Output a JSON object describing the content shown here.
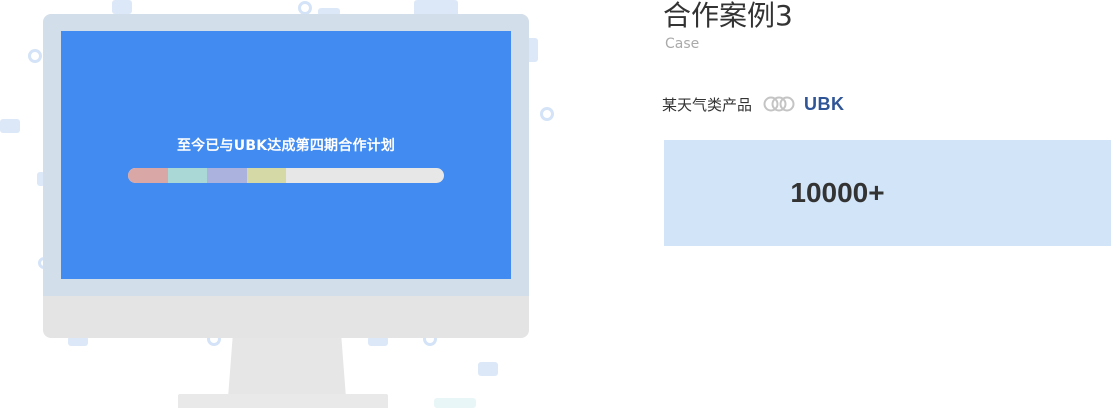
{
  "screen": {
    "text": "至今已与UBK达成第四期合作计划",
    "progress_segments": [
      {
        "color": "#d9a8a6"
      },
      {
        "color": "#aad8d6"
      },
      {
        "color": "#aab2dd"
      },
      {
        "color": "#d5d9a5"
      }
    ],
    "progress_fraction": 0.5
  },
  "case": {
    "title": "合作案例3",
    "subtitle": "Case",
    "partner_name": "某天气类产品",
    "link_icon": "chain-link-icon",
    "brand_logo": "UBK",
    "stat_value": "10000+"
  },
  "colors": {
    "screen_blue": "#428bf0",
    "stat_box": "#d2e4f8",
    "brand": "#2f5597"
  }
}
